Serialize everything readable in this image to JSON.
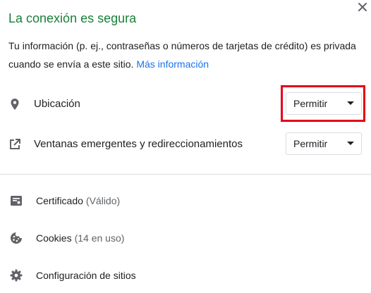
{
  "header": {
    "title": "La conexión es segura",
    "close_label": "✕"
  },
  "description": {
    "text": "Tu información (p. ej., contraseñas o números de tarjetas de crédito) es privada cuando se envía a este sitio.",
    "link": "Más información"
  },
  "permissions": [
    {
      "icon": "location-pin-icon",
      "label": "Ubicación",
      "value": "Permitir",
      "highlighted": true
    },
    {
      "icon": "open-in-new-icon",
      "label": "Ventanas emergentes y redireccionamientos",
      "value": "Permitir",
      "highlighted": false
    }
  ],
  "menu": [
    {
      "icon": "certificate-icon",
      "label": "Certificado",
      "sub": "(Válido)"
    },
    {
      "icon": "cookie-icon",
      "label": "Cookies",
      "sub": "(14 en uso)"
    },
    {
      "icon": "gear-icon",
      "label": "Configuración de sitios",
      "sub": ""
    }
  ],
  "colors": {
    "secure_green": "#188038",
    "link_blue": "#1a73e8",
    "highlight_red": "#e3001b"
  }
}
